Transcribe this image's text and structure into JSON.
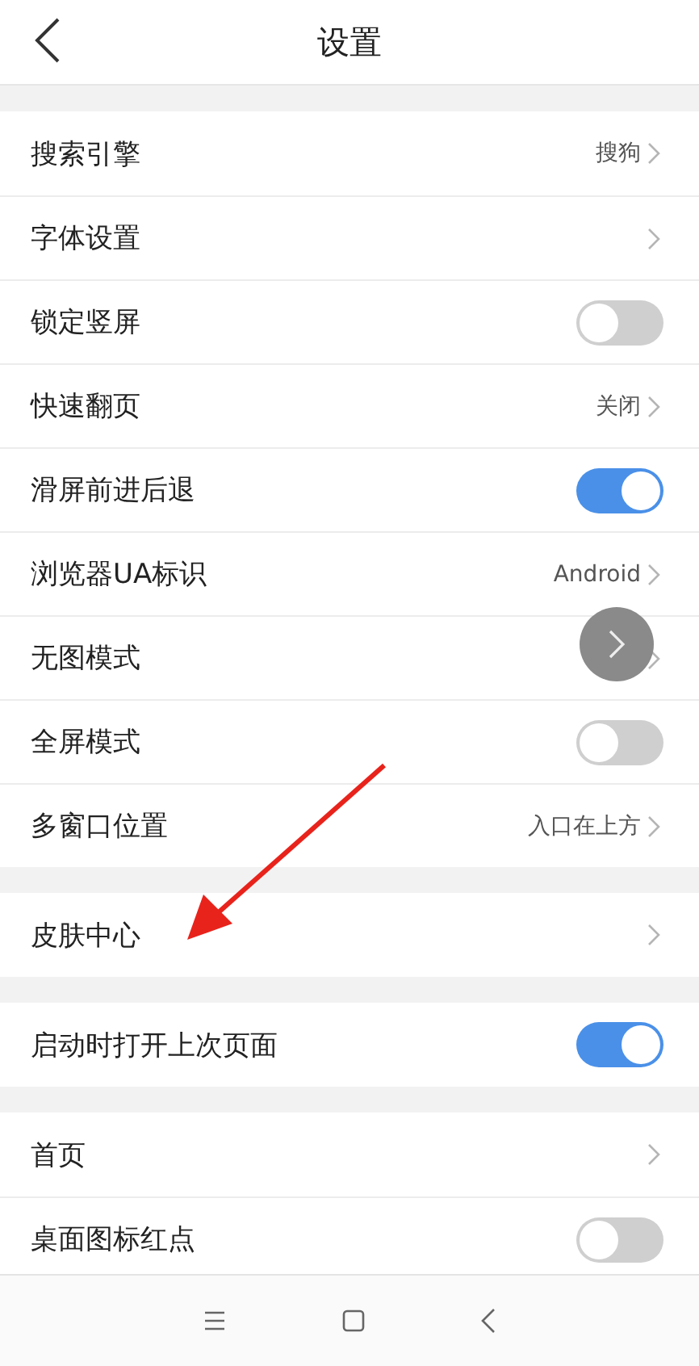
{
  "header": {
    "title": "设置"
  },
  "groups": [
    {
      "rows": [
        {
          "label": "搜索引擎",
          "kind": "link",
          "value": "搜狗"
        },
        {
          "label": "字体设置",
          "kind": "link"
        },
        {
          "label": "锁定竖屏",
          "kind": "toggle",
          "on": false
        },
        {
          "label": "快速翻页",
          "kind": "link",
          "value": "关闭"
        },
        {
          "label": "滑屏前进后退",
          "kind": "toggle",
          "on": true
        },
        {
          "label": "浏览器UA标识",
          "kind": "link",
          "value": "Android"
        },
        {
          "label": "无图模式",
          "kind": "link"
        },
        {
          "label": "全屏模式",
          "kind": "toggle",
          "on": false
        },
        {
          "label": "多窗口位置",
          "kind": "link",
          "value": "入口在上方"
        }
      ]
    },
    {
      "rows": [
        {
          "label": "皮肤中心",
          "kind": "link"
        }
      ]
    },
    {
      "rows": [
        {
          "label": "启动时打开上次页面",
          "kind": "toggle",
          "on": true
        }
      ]
    },
    {
      "rows": [
        {
          "label": "首页",
          "kind": "link"
        },
        {
          "label": "桌面图标红点",
          "kind": "toggle",
          "on": false
        }
      ]
    }
  ]
}
